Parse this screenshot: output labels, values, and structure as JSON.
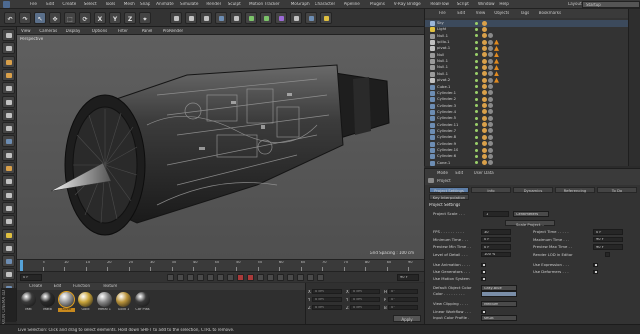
{
  "menubar": {
    "items": [
      "File",
      "Edit",
      "Create",
      "Select",
      "Tools",
      "Mesh",
      "Snap",
      "Animate",
      "Simulate",
      "Render",
      "Sculpt",
      "Motion Tracker",
      "MoGraph",
      "Character",
      "Pipeline",
      "Plugins",
      "V-Ray Bridge",
      "RealFlow",
      "Script",
      "Window",
      "Help"
    ],
    "layout_label": "Layout:",
    "layout_value": "Startup"
  },
  "toolbar": {
    "buttons": [
      "↶",
      "↷",
      "↖",
      "✥",
      "⬚",
      "⟳",
      "X",
      "Y",
      "Z",
      "⌖"
    ]
  },
  "viewport": {
    "menu": [
      "View",
      "Cameras",
      "Display",
      "Options",
      "Filter",
      "Panel",
      "ProRender"
    ],
    "label": "Perspective",
    "grid_spacing": "Grid Spacing : 100 cm"
  },
  "timeline": {
    "ticks": [
      "0",
      "5",
      "10",
      "15",
      "20",
      "25",
      "30",
      "35",
      "40",
      "45",
      "50",
      "55",
      "60",
      "65",
      "70",
      "75",
      "80",
      "85",
      "90"
    ],
    "start_frame": "0 F",
    "end_frame": "90 F"
  },
  "material_manager": {
    "menu": [
      "Create",
      "Edit",
      "Function",
      "Texture"
    ],
    "materials": [
      {
        "name": "Mat",
        "color": "#3a3a3a"
      },
      {
        "name": "Matb",
        "color": "#2a2a2a"
      },
      {
        "name": "Silver",
        "color": "#9c9c9c"
      },
      {
        "name": "Gold",
        "color": "#c9a43a"
      },
      {
        "name": "Metal 1",
        "color": "#8a8a8a"
      },
      {
        "name": "Gold 1",
        "color": "#b8923a"
      },
      {
        "name": "Car Plas",
        "color": "#3a3a3a"
      }
    ]
  },
  "coordinates": {
    "rows": [
      {
        "axis": "X",
        "pos": "0 cm",
        "size_axis": "X",
        "size": "0 cm",
        "rot_axis": "H",
        "rot": "0°"
      },
      {
        "axis": "Y",
        "pos": "0 cm",
        "size_axis": "Y",
        "size": "0 cm",
        "rot_axis": "P",
        "rot": "0°"
      },
      {
        "axis": "Z",
        "pos": "0 cm",
        "size_axis": "Z",
        "size": "0 cm",
        "rot_axis": "B",
        "rot": "0°"
      }
    ],
    "apply_label": "Apply"
  },
  "object_manager": {
    "menu": [
      "File",
      "Edit",
      "View",
      "Objects",
      "Tags",
      "Bookmarks"
    ],
    "objects": [
      "Sky",
      "Light",
      "Null.1",
      "ipillo.1",
      "pivot.1",
      "Null",
      "Null.1",
      "Null.1",
      "Null.1",
      "pivot.2",
      "Cube.1",
      "Cylinder.1",
      "Cylinder.2",
      "Cylinder.3",
      "Cylinder.4",
      "Cylinder.5",
      "Cylinder.11",
      "Cylinder.7",
      "Cylinder.8",
      "Cylinder.9",
      "Cylinder.10",
      "Cylinder.6",
      "Cone.1"
    ]
  },
  "attribute_manager": {
    "menu": [
      "Mode",
      "Edit",
      "User Data"
    ],
    "title": "Project",
    "tabs_row1": [
      "Project Settings",
      "Info",
      "Dynamics",
      "Referencing",
      "To Do"
    ],
    "tabs_row2": [
      "Key Interpolation"
    ],
    "section": "Project Settings",
    "project_scale_label": "Project Scale . . .",
    "project_scale_value": "1",
    "project_scale_unit": "Centimeters",
    "scale_project_button": "Scale Project...",
    "fields_left": [
      {
        "label": "FPS . . . . . . . . . .",
        "value": "30"
      },
      {
        "label": "Minimum Time . . .",
        "value": "0 F"
      },
      {
        "label": "Preview Min Time . .",
        "value": "0 F"
      },
      {
        "label": "Level of Detail . . .",
        "value": "100 %"
      }
    ],
    "fields_right": [
      {
        "label": "Project Time . . . . .",
        "value": "0 F"
      },
      {
        "label": "Maximum Time . . .",
        "value": "90 F"
      },
      {
        "label": "Preview Max Time . .",
        "value": "90 F"
      }
    ],
    "render_lod_label": "Render LOD in Editor",
    "checks_left": [
      "Use Animation . . . .",
      "Use Generators . . .",
      "Use Motion System"
    ],
    "checks_right": [
      "Use Expression . . .",
      "Use Deformers . . ."
    ],
    "default_color_label": "Default Object Color",
    "default_color_value": "Gray-Blue",
    "color_label": "Color . . . . . . . . .",
    "view_clipping_label": "View Clipping . . . .",
    "view_clipping_value": "Medium",
    "linear_workflow_label": "Linear Workflow . . .",
    "input_color_profile_label": "Input Color Profile .",
    "input_color_profile_value": "sRGB"
  },
  "status": {
    "text": "Live Selection: Click and drag to select elements. Hold down SHIFT to add to the selection, CTRL to remove."
  },
  "logo_text": "MAXON CINEMA 4D"
}
